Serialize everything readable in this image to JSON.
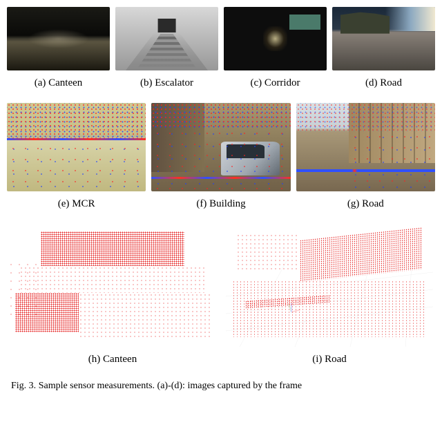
{
  "figure": {
    "number": "Fig. 3.",
    "caption_fragment": "Sample sensor measurements. (a)-(d): images captured by the frame"
  },
  "panels": {
    "a": {
      "tag": "(a)",
      "label": "Canteen"
    },
    "b": {
      "tag": "(b)",
      "label": "Escalator"
    },
    "c": {
      "tag": "(c)",
      "label": "Corridor"
    },
    "d": {
      "tag": "(d)",
      "label": "Road"
    },
    "e": {
      "tag": "(e)",
      "label": "MCR"
    },
    "f": {
      "tag": "(f)",
      "label": "Building"
    },
    "g": {
      "tag": "(g)",
      "label": "Road"
    },
    "h": {
      "tag": "(h)",
      "label": "Canteen"
    },
    "i": {
      "tag": "(i)",
      "label": "Road"
    }
  }
}
